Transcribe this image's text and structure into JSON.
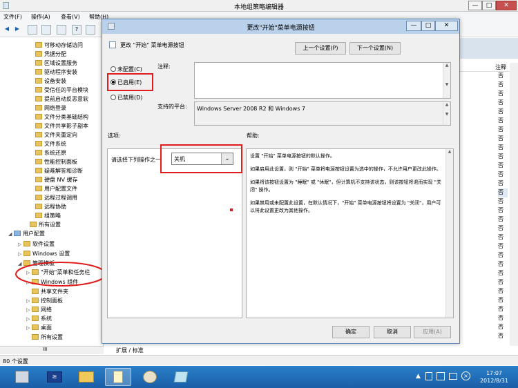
{
  "main_window": {
    "title": "本地组策略编辑器",
    "controls": {
      "minimize": "—",
      "maximize": "□",
      "close": "✕"
    }
  },
  "menu": [
    "文件(F)",
    "操作(A)",
    "查看(V)",
    "帮助(H)"
  ],
  "tree": [
    {
      "label": "可移动存储访问"
    },
    {
      "label": "凭据分配"
    },
    {
      "label": "区域设置服务"
    },
    {
      "label": "驱动程序安装"
    },
    {
      "label": "设备安装"
    },
    {
      "label": "受信任的平台模块"
    },
    {
      "label": "提前启动反恶意软"
    },
    {
      "label": "网络登录"
    },
    {
      "label": "文件分类基础结构"
    },
    {
      "label": "文件共享影子副本"
    },
    {
      "label": "文件夹重定向"
    },
    {
      "label": "文件系统"
    },
    {
      "label": "系统还原"
    },
    {
      "label": "性能控制面板"
    },
    {
      "label": "疑难解答和诊断"
    },
    {
      "label": "硬盘 NV 缓存"
    },
    {
      "label": "用户配置文件"
    },
    {
      "label": "远程过程调用"
    },
    {
      "label": "远程协助"
    },
    {
      "label": "组策略"
    },
    {
      "label": "所有设置"
    },
    {
      "label": "用户配置"
    },
    {
      "label": "软件设置"
    },
    {
      "label": "Windows 设置"
    },
    {
      "label": "管理模板"
    },
    {
      "label": "\"开始\"菜单和任务栏"
    },
    {
      "label": "Windows 组件"
    },
    {
      "label": "共享文件夹"
    },
    {
      "label": "控制面板"
    },
    {
      "label": "网络"
    },
    {
      "label": "系统"
    },
    {
      "label": "桌面"
    },
    {
      "label": "所有设置"
    }
  ],
  "right_list": {
    "column_header": "注释",
    "values": [
      "否",
      "否",
      "否",
      "否",
      "否",
      "否",
      "否",
      "否",
      "否",
      "否",
      "否",
      "否",
      "否",
      "否",
      "否",
      "否",
      "否",
      "否",
      "否",
      "否",
      "否",
      "否",
      "否",
      "否",
      "否",
      "否",
      "否",
      "否",
      "否",
      "否"
    ]
  },
  "tabs": "扩展 / 标准",
  "status": "80 个设置",
  "taskbar": {
    "time": "17:07",
    "date": "2012/8/31"
  },
  "dialog": {
    "title": "更改\"开始\"菜单电源按钮",
    "controls": {
      "minimize": "—",
      "maximize": "□",
      "close": "✕"
    },
    "setting_name": "更改 \"开始\" 菜单电源按钮",
    "prev_button": "上一个设置(P)",
    "next_button": "下一个设置(N)",
    "radio_not_configured": "未配置(C)",
    "radio_enabled": "已启用(E)",
    "radio_disabled": "已禁用(D)",
    "comment_label": "注释:",
    "supported_label": "支持的平台:",
    "supported_value": "Windows Server 2008 R2 和 Windows 7",
    "options_label": "选项:",
    "help_label": "帮助:",
    "option_prompt": "请选择下列操作之一",
    "option_value": "关机",
    "help_paragraphs": [
      "设置 \"开始\" 菜单电源按钮的默认操作。",
      "如果启用此设置，则 \"开始\" 菜单将电源按钮设置为选中的操作，不允许用户更改此操作。",
      "如果将该按钮设置为 \"睡眠\" 或 \"休眠\"，但计算机不支持该状态，则该按钮将退而实现 \"关闭\" 操作。",
      "如果禁用或未配置此设置，在默认情况下，\"开始\" 菜单电源按钮将设置为 \"关闭\"，用户可以将此设置更改为其他操作。"
    ],
    "ok_button": "确定",
    "cancel_button": "取消",
    "apply_button": "应用(A)"
  }
}
